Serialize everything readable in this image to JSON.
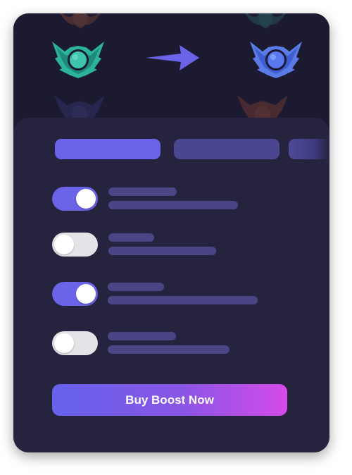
{
  "colors": {
    "background": "#1c1a30",
    "panel": "#26233f",
    "accent": "#6c64e8",
    "toggle_off": "#e4e4e8",
    "button_gradient_start": "#6562ec",
    "button_gradient_end": "#d64ae8"
  },
  "header": {
    "current_rank_icon": "teal-winged-rank-emblem",
    "target_rank_icon": "blue-winged-rank-emblem",
    "arrow_icon": "arrow-right-icon"
  },
  "tabs": [
    {
      "state": "active"
    },
    {
      "state": "inactive"
    },
    {
      "state": "inactive"
    }
  ],
  "options": [
    {
      "enabled": true
    },
    {
      "enabled": false
    },
    {
      "enabled": true
    },
    {
      "enabled": false
    }
  ],
  "cta": {
    "label": "Buy Boost Now"
  }
}
